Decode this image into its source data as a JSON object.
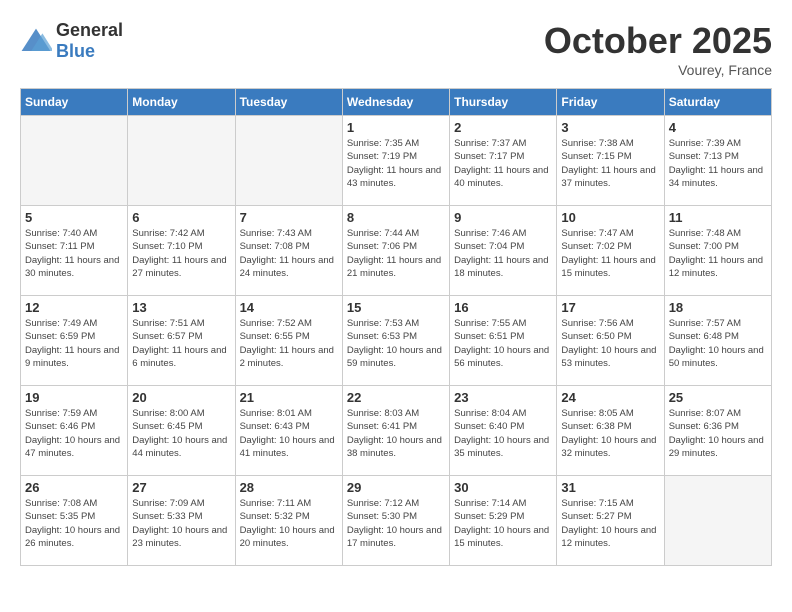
{
  "header": {
    "logo_general": "General",
    "logo_blue": "Blue",
    "month_title": "October 2025",
    "location": "Vourey, France"
  },
  "days_of_week": [
    "Sunday",
    "Monday",
    "Tuesday",
    "Wednesday",
    "Thursday",
    "Friday",
    "Saturday"
  ],
  "weeks": [
    [
      {
        "day": "",
        "info": ""
      },
      {
        "day": "",
        "info": ""
      },
      {
        "day": "",
        "info": ""
      },
      {
        "day": "1",
        "info": "Sunrise: 7:35 AM\nSunset: 7:19 PM\nDaylight: 11 hours and 43 minutes."
      },
      {
        "day": "2",
        "info": "Sunrise: 7:37 AM\nSunset: 7:17 PM\nDaylight: 11 hours and 40 minutes."
      },
      {
        "day": "3",
        "info": "Sunrise: 7:38 AM\nSunset: 7:15 PM\nDaylight: 11 hours and 37 minutes."
      },
      {
        "day": "4",
        "info": "Sunrise: 7:39 AM\nSunset: 7:13 PM\nDaylight: 11 hours and 34 minutes."
      }
    ],
    [
      {
        "day": "5",
        "info": "Sunrise: 7:40 AM\nSunset: 7:11 PM\nDaylight: 11 hours and 30 minutes."
      },
      {
        "day": "6",
        "info": "Sunrise: 7:42 AM\nSunset: 7:10 PM\nDaylight: 11 hours and 27 minutes."
      },
      {
        "day": "7",
        "info": "Sunrise: 7:43 AM\nSunset: 7:08 PM\nDaylight: 11 hours and 24 minutes."
      },
      {
        "day": "8",
        "info": "Sunrise: 7:44 AM\nSunset: 7:06 PM\nDaylight: 11 hours and 21 minutes."
      },
      {
        "day": "9",
        "info": "Sunrise: 7:46 AM\nSunset: 7:04 PM\nDaylight: 11 hours and 18 minutes."
      },
      {
        "day": "10",
        "info": "Sunrise: 7:47 AM\nSunset: 7:02 PM\nDaylight: 11 hours and 15 minutes."
      },
      {
        "day": "11",
        "info": "Sunrise: 7:48 AM\nSunset: 7:00 PM\nDaylight: 11 hours and 12 minutes."
      }
    ],
    [
      {
        "day": "12",
        "info": "Sunrise: 7:49 AM\nSunset: 6:59 PM\nDaylight: 11 hours and 9 minutes."
      },
      {
        "day": "13",
        "info": "Sunrise: 7:51 AM\nSunset: 6:57 PM\nDaylight: 11 hours and 6 minutes."
      },
      {
        "day": "14",
        "info": "Sunrise: 7:52 AM\nSunset: 6:55 PM\nDaylight: 11 hours and 2 minutes."
      },
      {
        "day": "15",
        "info": "Sunrise: 7:53 AM\nSunset: 6:53 PM\nDaylight: 10 hours and 59 minutes."
      },
      {
        "day": "16",
        "info": "Sunrise: 7:55 AM\nSunset: 6:51 PM\nDaylight: 10 hours and 56 minutes."
      },
      {
        "day": "17",
        "info": "Sunrise: 7:56 AM\nSunset: 6:50 PM\nDaylight: 10 hours and 53 minutes."
      },
      {
        "day": "18",
        "info": "Sunrise: 7:57 AM\nSunset: 6:48 PM\nDaylight: 10 hours and 50 minutes."
      }
    ],
    [
      {
        "day": "19",
        "info": "Sunrise: 7:59 AM\nSunset: 6:46 PM\nDaylight: 10 hours and 47 minutes."
      },
      {
        "day": "20",
        "info": "Sunrise: 8:00 AM\nSunset: 6:45 PM\nDaylight: 10 hours and 44 minutes."
      },
      {
        "day": "21",
        "info": "Sunrise: 8:01 AM\nSunset: 6:43 PM\nDaylight: 10 hours and 41 minutes."
      },
      {
        "day": "22",
        "info": "Sunrise: 8:03 AM\nSunset: 6:41 PM\nDaylight: 10 hours and 38 minutes."
      },
      {
        "day": "23",
        "info": "Sunrise: 8:04 AM\nSunset: 6:40 PM\nDaylight: 10 hours and 35 minutes."
      },
      {
        "day": "24",
        "info": "Sunrise: 8:05 AM\nSunset: 6:38 PM\nDaylight: 10 hours and 32 minutes."
      },
      {
        "day": "25",
        "info": "Sunrise: 8:07 AM\nSunset: 6:36 PM\nDaylight: 10 hours and 29 minutes."
      }
    ],
    [
      {
        "day": "26",
        "info": "Sunrise: 7:08 AM\nSunset: 5:35 PM\nDaylight: 10 hours and 26 minutes."
      },
      {
        "day": "27",
        "info": "Sunrise: 7:09 AM\nSunset: 5:33 PM\nDaylight: 10 hours and 23 minutes."
      },
      {
        "day": "28",
        "info": "Sunrise: 7:11 AM\nSunset: 5:32 PM\nDaylight: 10 hours and 20 minutes."
      },
      {
        "day": "29",
        "info": "Sunrise: 7:12 AM\nSunset: 5:30 PM\nDaylight: 10 hours and 17 minutes."
      },
      {
        "day": "30",
        "info": "Sunrise: 7:14 AM\nSunset: 5:29 PM\nDaylight: 10 hours and 15 minutes."
      },
      {
        "day": "31",
        "info": "Sunrise: 7:15 AM\nSunset: 5:27 PM\nDaylight: 10 hours and 12 minutes."
      },
      {
        "day": "",
        "info": ""
      }
    ]
  ]
}
